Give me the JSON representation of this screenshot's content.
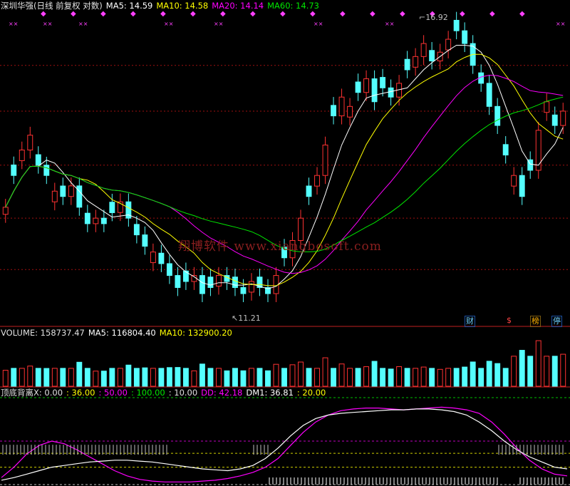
{
  "header_main": {
    "title": "深圳华强(日线 前复权 对数)",
    "ma5": "MA5: 14.59",
    "ma10": "MA10: 14.58",
    "ma20": "MA20: 14.14",
    "ma60": "MA60: 14.73"
  },
  "header_volume": {
    "volume": "VOLUME: 158737.47",
    "ma5": "MA5: 116804.40",
    "ma10": "MA10: 132900.20"
  },
  "header_indicator": {
    "name": "顶底背离X",
    "v1": ": 0.00",
    "v2": ": 36.00",
    "v3": ": 50.00",
    "v4": ": 100.00",
    "v5": ": 10.00",
    "dd": "DD: 42.18",
    "dm1": "DM1: 36.81",
    "v8": ": 20.00"
  },
  "annotations": {
    "high": "16.92",
    "low": "11.21"
  },
  "watermark": "翔博软件 www.xiangbosoft.com",
  "badges": {
    "cai": "财",
    "dollar": "$",
    "bang": "榜",
    "ting": "停"
  },
  "colors": {
    "up": "#ff3232",
    "down": "#54ffff",
    "ma5": "#ffffff",
    "ma10": "#ffff00",
    "ma20": "#ff00ff",
    "ma60": "#00e600",
    "dd": "#ff00ff",
    "dm1": "#ffffff",
    "grid": "#a01010"
  },
  "chart_data": [
    {
      "type": "candlestick",
      "title": "深圳华强(日线 前复权 对数)",
      "scale": "log",
      "ylim": [
        11.0,
        17.2
      ],
      "gridlines": [
        11.9,
        12.8,
        13.8,
        14.9,
        15.9
      ],
      "max_label": 16.92,
      "min_label": 11.21,
      "series_names": [
        "MA5",
        "MA10",
        "MA20",
        "MA60"
      ],
      "closes": [
        13.0,
        13.6,
        14.1,
        14.4,
        13.8,
        13.6,
        13.3,
        13.2,
        13.4,
        13.0,
        12.7,
        12.8,
        12.7,
        12.9,
        13.1,
        12.8,
        12.5,
        12.3,
        12.2,
        12.0,
        11.8,
        11.6,
        11.7,
        11.8,
        11.5,
        11.6,
        11.8,
        11.7,
        11.6,
        11.5,
        11.7,
        11.6,
        11.5,
        11.8,
        12.1,
        12.4,
        12.8,
        13.2,
        13.6,
        14.2,
        14.8,
        15.2,
        15.0,
        15.3,
        15.6,
        15.1,
        15.4,
        15.2,
        15.5,
        15.8,
        16.1,
        16.4,
        16.0,
        16.2,
        16.5,
        16.7,
        16.4,
        15.9,
        15.5,
        15.0,
        14.6,
        14.0,
        13.6,
        13.2,
        13.7,
        14.5,
        15.1,
        14.6,
        14.9
      ],
      "volume": {
        "title": "VOLUME",
        "last": 158737.47,
        "ma5": 116804.4,
        "ma10": 132900.2
      }
    },
    {
      "type": "line",
      "title": "顶底背离X",
      "ylim": [
        0,
        100
      ],
      "reference_levels": [
        0,
        20,
        36,
        50,
        100
      ],
      "series": [
        {
          "name": "DD",
          "values": [
            8,
            20,
            35,
            45,
            50,
            47,
            40,
            32,
            24,
            16,
            10,
            6,
            4,
            3,
            3,
            3,
            4,
            5,
            7,
            10,
            14,
            20,
            30,
            45,
            60,
            72,
            80,
            85,
            87,
            88,
            88,
            87,
            86,
            87,
            88,
            89,
            88,
            86,
            82,
            72,
            58,
            42,
            28,
            18,
            12,
            10
          ]
        },
        {
          "name": "DM1",
          "values": [
            5,
            8,
            12,
            16,
            20,
            22,
            24,
            26,
            27,
            28,
            28,
            27,
            26,
            24,
            22,
            20,
            18,
            17,
            16,
            18,
            22,
            30,
            42,
            56,
            68,
            76,
            80,
            82,
            83,
            84,
            85,
            86,
            86,
            87,
            87,
            86,
            84,
            80,
            72,
            62,
            50,
            40,
            32,
            26,
            20,
            18
          ]
        }
      ]
    }
  ]
}
